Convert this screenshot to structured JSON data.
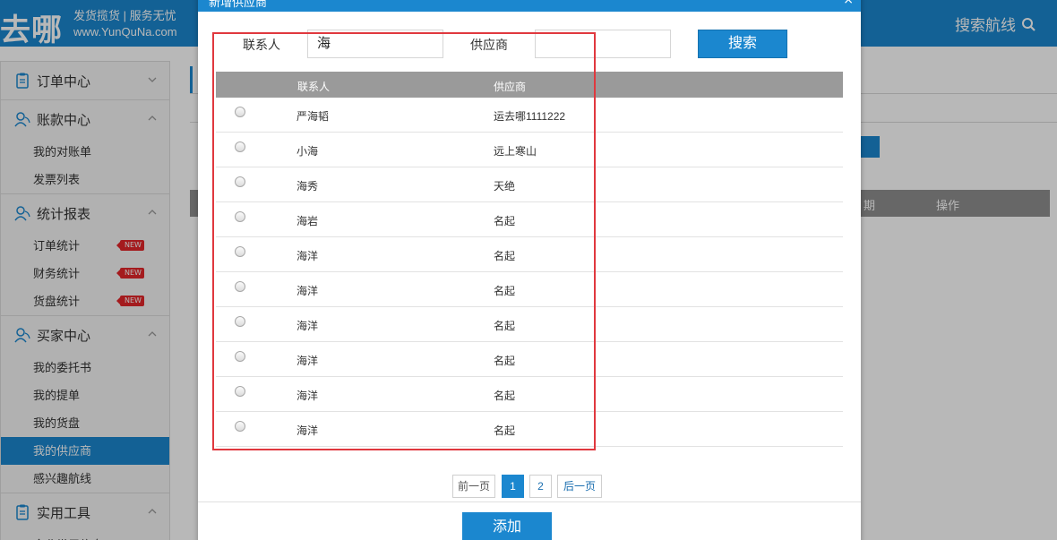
{
  "header": {
    "logo_text": "去哪",
    "tagline_line1": "发货揽货 | 服务无忧",
    "tagline_line2": "www.YunQuNa.com",
    "search_route_label": "搜索航线",
    "search_icon": "search-icon"
  },
  "sidebar": {
    "groups": [
      {
        "title": "订单中心",
        "icon": "clipboard-icon",
        "expanded": false,
        "items": []
      },
      {
        "title": "账款中心",
        "icon": "user-icon",
        "expanded": true,
        "items": [
          {
            "label": "我的对账单"
          },
          {
            "label": "发票列表"
          }
        ]
      },
      {
        "title": "统计报表",
        "icon": "user-icon",
        "expanded": true,
        "items": [
          {
            "label": "订单统计",
            "badge": "NEW"
          },
          {
            "label": "财务统计",
            "badge": "NEW"
          },
          {
            "label": "货盘统计",
            "badge": "NEW"
          }
        ]
      },
      {
        "title": "买家中心",
        "icon": "user-icon",
        "expanded": true,
        "items": [
          {
            "label": "我的委托书"
          },
          {
            "label": "我的提单"
          },
          {
            "label": "我的货盘"
          },
          {
            "label": "我的供应商",
            "active": true
          },
          {
            "label": "感兴趣航线"
          }
        ]
      },
      {
        "title": "实用工具",
        "icon": "clipboard-icon",
        "expanded": true,
        "items": [
          {
            "label": "企业常用信息"
          }
        ]
      }
    ]
  },
  "background": {
    "columns": [
      "期",
      "操作"
    ]
  },
  "modal": {
    "title": "新增供应商",
    "filter": {
      "contact_label": "联系人",
      "contact_value": "海",
      "supplier_label": "供应商",
      "supplier_value": "",
      "search_button": "搜索"
    },
    "table": {
      "headers": [
        "联系人",
        "供应商"
      ],
      "rows": [
        {
          "contact": "严海韬",
          "supplier": "运去哪1111222"
        },
        {
          "contact": "小海",
          "supplier": "远上寒山"
        },
        {
          "contact": "海秀",
          "supplier": "天绝"
        },
        {
          "contact": "海岩",
          "supplier": "名起"
        },
        {
          "contact": "海洋",
          "supplier": "名起"
        },
        {
          "contact": "海洋",
          "supplier": "名起"
        },
        {
          "contact": "海洋",
          "supplier": "名起"
        },
        {
          "contact": "海洋",
          "supplier": "名起"
        },
        {
          "contact": "海洋",
          "supplier": "名起"
        },
        {
          "contact": "海洋",
          "supplier": "名起"
        }
      ]
    },
    "pagination": {
      "prev": "前一页",
      "pages": [
        "1",
        "2"
      ],
      "current": "1",
      "next": "后一页"
    },
    "add_button": "添加"
  },
  "colors": {
    "primary": "#1b87cf",
    "table_header": "#9a9a9a",
    "highlight": "#e0383e",
    "new_badge": "#e3262a"
  }
}
